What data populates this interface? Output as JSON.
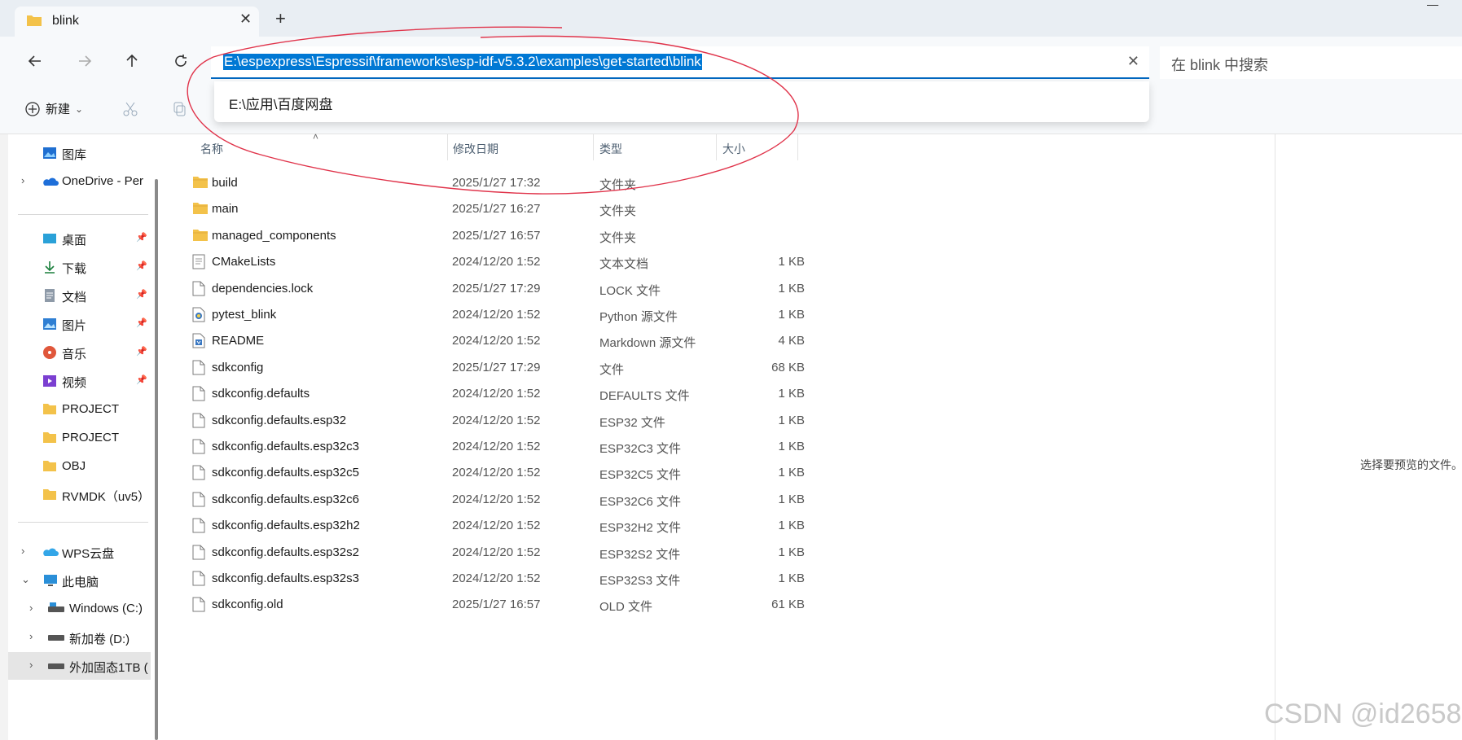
{
  "window": {
    "tab_title": "blink",
    "new_tab": "+",
    "tab_close": "✕"
  },
  "nav": {
    "address_path": "E:\\espexpress\\Espressif\\frameworks\\esp-idf-v5.3.2\\examples\\get-started\\blink",
    "address_clear": "✕",
    "search_placeholder": "在 blink 中搜索",
    "suggestion": "E:\\应用\\百度网盘"
  },
  "toolbar": {
    "new_label": "新建",
    "new_chevron": "⌄"
  },
  "sidebar": {
    "items": [
      {
        "label": "图库",
        "icon": "gallery-icon",
        "pinned": false
      },
      {
        "label": "OneDrive - Per",
        "icon": "onedrive-icon",
        "pinned": false
      },
      {
        "label": "桌面",
        "icon": "desktop-icon",
        "pinned": true
      },
      {
        "label": "下载",
        "icon": "download-icon",
        "pinned": true
      },
      {
        "label": "文档",
        "icon": "documents-icon",
        "pinned": true
      },
      {
        "label": "图片",
        "icon": "pictures-icon",
        "pinned": true
      },
      {
        "label": "音乐",
        "icon": "music-icon",
        "pinned": true
      },
      {
        "label": "视频",
        "icon": "videos-icon",
        "pinned": true
      },
      {
        "label": "PROJECT",
        "icon": "folder-icon",
        "pinned": false
      },
      {
        "label": "PROJECT",
        "icon": "folder-icon",
        "pinned": false
      },
      {
        "label": "OBJ",
        "icon": "folder-icon",
        "pinned": false
      },
      {
        "label": "RVMDK（uv5）",
        "icon": "folder-icon",
        "pinned": false
      },
      {
        "label": "WPS云盘",
        "icon": "wps-cloud-icon",
        "pinned": false
      },
      {
        "label": "此电脑",
        "icon": "this-pc-icon",
        "pinned": false
      },
      {
        "label": "Windows (C:)",
        "icon": "drive-icon",
        "pinned": false
      },
      {
        "label": "新加卷 (D:)",
        "icon": "drive-icon",
        "pinned": false
      },
      {
        "label": "外加固态1TB (",
        "icon": "drive-icon",
        "pinned": false
      }
    ]
  },
  "columns": {
    "name": "名称",
    "date": "修改日期",
    "type": "类型",
    "size": "大小"
  },
  "files": [
    {
      "name": "build",
      "date": "2025/1/27 17:32",
      "type": "文件夹",
      "size": "",
      "kind": "folder"
    },
    {
      "name": "main",
      "date": "2025/1/27 16:27",
      "type": "文件夹",
      "size": "",
      "kind": "folder"
    },
    {
      "name": "managed_components",
      "date": "2025/1/27 16:57",
      "type": "文件夹",
      "size": "",
      "kind": "folder"
    },
    {
      "name": "CMakeLists",
      "date": "2024/12/20 1:52",
      "type": "文本文档",
      "size": "1 KB",
      "kind": "text"
    },
    {
      "name": "dependencies.lock",
      "date": "2025/1/27 17:29",
      "type": "LOCK 文件",
      "size": "1 KB",
      "kind": "file"
    },
    {
      "name": "pytest_blink",
      "date": "2024/12/20 1:52",
      "type": "Python 源文件",
      "size": "1 KB",
      "kind": "python"
    },
    {
      "name": "README",
      "date": "2024/12/20 1:52",
      "type": "Markdown 源文件",
      "size": "4 KB",
      "kind": "markdown"
    },
    {
      "name": "sdkconfig",
      "date": "2025/1/27 17:29",
      "type": "文件",
      "size": "68 KB",
      "kind": "file"
    },
    {
      "name": "sdkconfig.defaults",
      "date": "2024/12/20 1:52",
      "type": "DEFAULTS 文件",
      "size": "1 KB",
      "kind": "file"
    },
    {
      "name": "sdkconfig.defaults.esp32",
      "date": "2024/12/20 1:52",
      "type": "ESP32 文件",
      "size": "1 KB",
      "kind": "file"
    },
    {
      "name": "sdkconfig.defaults.esp32c3",
      "date": "2024/12/20 1:52",
      "type": "ESP32C3 文件",
      "size": "1 KB",
      "kind": "file"
    },
    {
      "name": "sdkconfig.defaults.esp32c5",
      "date": "2024/12/20 1:52",
      "type": "ESP32C5 文件",
      "size": "1 KB",
      "kind": "file"
    },
    {
      "name": "sdkconfig.defaults.esp32c6",
      "date": "2024/12/20 1:52",
      "type": "ESP32C6 文件",
      "size": "1 KB",
      "kind": "file"
    },
    {
      "name": "sdkconfig.defaults.esp32h2",
      "date": "2024/12/20 1:52",
      "type": "ESP32H2 文件",
      "size": "1 KB",
      "kind": "file"
    },
    {
      "name": "sdkconfig.defaults.esp32s2",
      "date": "2024/12/20 1:52",
      "type": "ESP32S2 文件",
      "size": "1 KB",
      "kind": "file"
    },
    {
      "name": "sdkconfig.defaults.esp32s3",
      "date": "2024/12/20 1:52",
      "type": "ESP32S3 文件",
      "size": "1 KB",
      "kind": "file"
    },
    {
      "name": "sdkconfig.old",
      "date": "2025/1/27 16:57",
      "type": "OLD 文件",
      "size": "61 KB",
      "kind": "file"
    }
  ],
  "preview": {
    "text": "选择要预览的文件。"
  },
  "watermark": "CSDN @id2658",
  "colors": {
    "accent": "#0078d4",
    "annotation": "#e0334a",
    "folder": "#f3c24a"
  }
}
